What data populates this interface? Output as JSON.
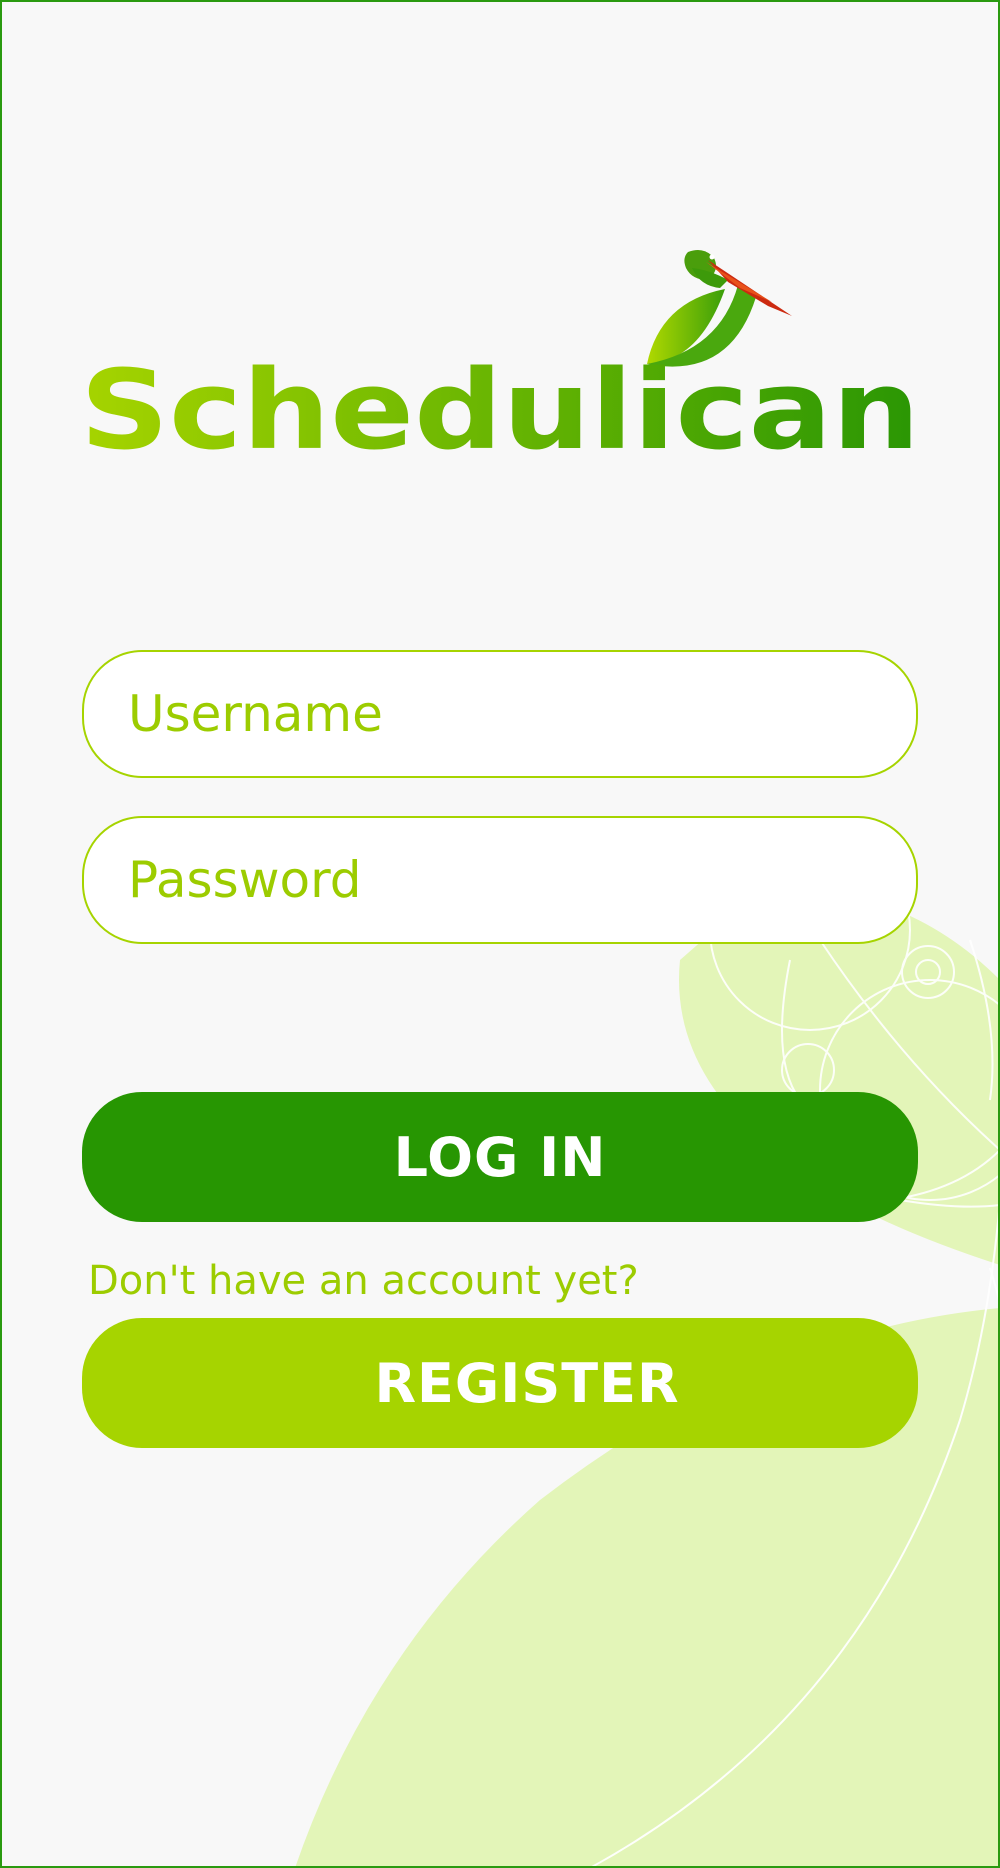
{
  "app": {
    "name": "Schedulican"
  },
  "form": {
    "username_placeholder": "Username",
    "password_placeholder": "Password",
    "login_label": "LOG IN",
    "register_prompt": "Don't have an account yet?",
    "register_label": "REGISTER"
  },
  "colors": {
    "primary_green": "#279602",
    "lime": "#a6d400",
    "lime_text": "#9ccc00",
    "background": "#f8f8f8",
    "decor": "#e3f5b8",
    "beak": "#e8511a"
  },
  "icons": {
    "logo_bird": "pelican-bird-icon"
  }
}
